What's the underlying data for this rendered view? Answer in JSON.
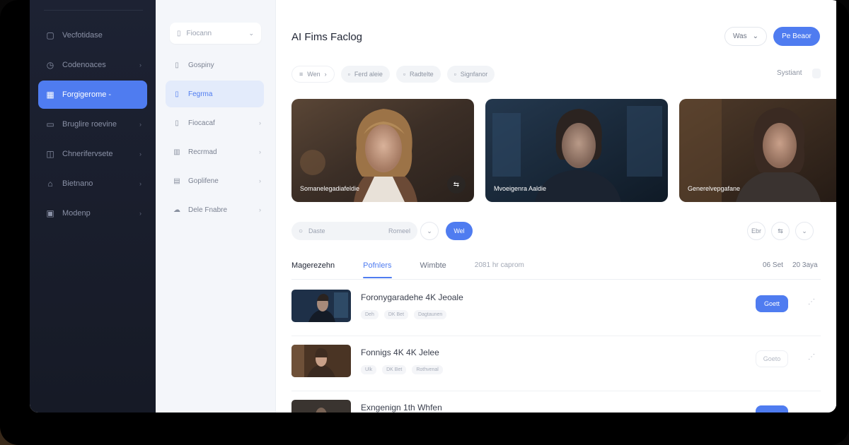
{
  "sidebar": {
    "items": [
      {
        "label": "Vecfotidase",
        "icon": "document-icon",
        "chevron": ""
      },
      {
        "label": "Codenoaces",
        "icon": "clock-icon",
        "chevron": "›"
      },
      {
        "label": "Forgigerome -",
        "icon": "grid-icon",
        "chevron": "",
        "active": true
      },
      {
        "label": "Bruglire roevine",
        "icon": "chat-icon",
        "chevron": "›"
      },
      {
        "label": "Chnerifervsete",
        "icon": "chart-icon",
        "chevron": "›"
      },
      {
        "label": "Bietnano",
        "icon": "home-icon",
        "chevron": "›"
      },
      {
        "label": "Modenp",
        "icon": "image-icon",
        "chevron": "›"
      }
    ]
  },
  "subnav": {
    "select": {
      "label": "Fiocann",
      "icon": "document-icon",
      "chevron": "⌄"
    },
    "items": [
      {
        "label": "Gospiny",
        "icon": "document-icon",
        "chevron": ""
      },
      {
        "label": "Fegrma",
        "icon": "document-icon",
        "chevron": "",
        "active": true
      },
      {
        "label": "Fiocacaf",
        "icon": "document-icon",
        "chevron": "›"
      },
      {
        "label": "Recrmad",
        "icon": "book-icon",
        "chevron": "›"
      },
      {
        "label": "Goplifene",
        "icon": "save-icon",
        "chevron": "›"
      },
      {
        "label": "Dele Fnabre",
        "icon": "cloud-icon",
        "chevron": "›"
      }
    ]
  },
  "header": {
    "title": "AI Fims Faclog",
    "view_label": "Was",
    "primary_label": "Pe Beaor"
  },
  "filters": {
    "chips": [
      "Wen",
      "Ferd aleie",
      "Radtelte",
      "Signfanor"
    ],
    "systems": "Systiant"
  },
  "cards": [
    {
      "label": "Somanelegadiafeldie",
      "badge": "⇆"
    },
    {
      "label": "Mvoeigenra Aaldie",
      "badge": ""
    },
    {
      "label": "Generelvepgafane",
      "badge": ""
    }
  ],
  "toolbar": {
    "search_placeholder": "Daste",
    "search_right": "Romeel",
    "go_label": "Wel",
    "tool_1": "Ebr",
    "tool_2": "⇆",
    "tool_3": "⌄"
  },
  "tabs": {
    "items": [
      "Magerezehn",
      "Pofnlers",
      "Wimbte",
      "2081 hr caprom"
    ],
    "right_1": "06 Set",
    "right_2": "20 3aya"
  },
  "rows": [
    {
      "title": "Foronygaradehe 4K Jeoale",
      "tags": [
        "Deh",
        "DK Bet",
        "Dagtaunen"
      ],
      "action": "Goett"
    },
    {
      "title": "Fonnigs 4K 4K Jelee",
      "tags": [
        "Ulk",
        "DK Bet",
        "Rothvenal"
      ],
      "action": "Goeto"
    },
    {
      "title": "Exngenign 1th Whfen",
      "tags": [],
      "action": ""
    }
  ]
}
